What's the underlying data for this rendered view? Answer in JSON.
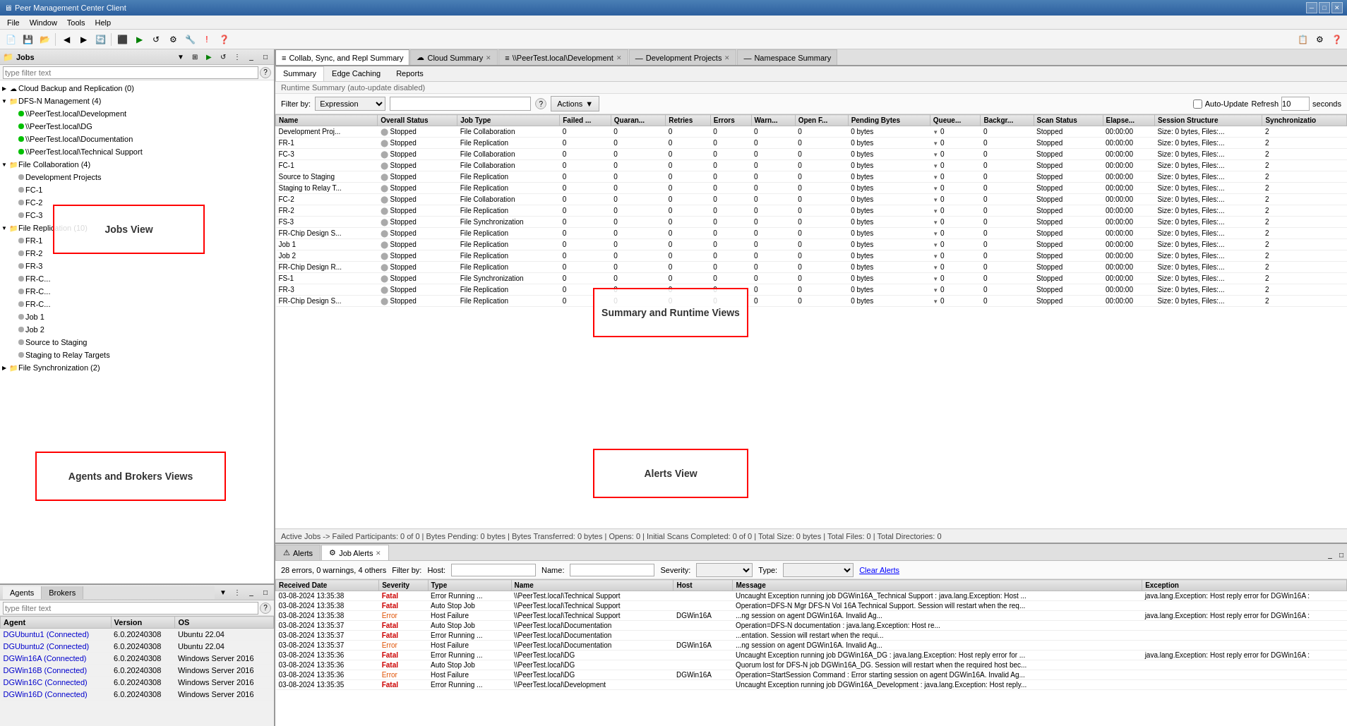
{
  "titleBar": {
    "title": "Peer Management Center Client",
    "icon": "🖥",
    "controls": [
      "─",
      "□",
      "✕"
    ]
  },
  "menuBar": {
    "items": [
      "File",
      "Window",
      "Tools",
      "Help"
    ]
  },
  "jobsPanel": {
    "title": "Jobs",
    "filterPlaceholder": "type filter text",
    "treeItems": [
      {
        "level": 0,
        "label": "Cloud Backup and Replication (0)",
        "icon": "☁",
        "expanded": true,
        "hasArrow": true
      },
      {
        "level": 0,
        "label": "DFS-N Management (4)",
        "icon": "📁",
        "expanded": true,
        "hasArrow": true
      },
      {
        "level": 1,
        "label": "\\\\PeerTest.local\\Development",
        "icon": "●",
        "dotColor": "green"
      },
      {
        "level": 1,
        "label": "\\\\PeerTest.local\\DG",
        "icon": "●",
        "dotColor": "green"
      },
      {
        "level": 1,
        "label": "\\\\PeerTest.local\\Documentation",
        "icon": "●",
        "dotColor": "green"
      },
      {
        "level": 1,
        "label": "\\\\PeerTest.local\\Technical Support",
        "icon": "●",
        "dotColor": "green"
      },
      {
        "level": 0,
        "label": "File Collaboration (4)",
        "icon": "📁",
        "expanded": true,
        "hasArrow": true
      },
      {
        "level": 1,
        "label": "Development Projects",
        "icon": "●",
        "dotColor": "gray"
      },
      {
        "level": 1,
        "label": "FC-1",
        "icon": "●",
        "dotColor": "gray"
      },
      {
        "level": 1,
        "label": "FC-2",
        "icon": "●",
        "dotColor": "gray"
      },
      {
        "level": 1,
        "label": "FC-3",
        "icon": "●",
        "dotColor": "gray"
      },
      {
        "level": 0,
        "label": "File Replication (10)",
        "icon": "📁",
        "expanded": true,
        "hasArrow": true
      },
      {
        "level": 1,
        "label": "FR-1",
        "icon": "●",
        "dotColor": "gray"
      },
      {
        "level": 1,
        "label": "FR-2",
        "icon": "●",
        "dotColor": "gray"
      },
      {
        "level": 1,
        "label": "FR-3",
        "icon": "●",
        "dotColor": "gray"
      },
      {
        "level": 1,
        "label": "FR-C...",
        "icon": "●",
        "dotColor": "gray"
      },
      {
        "level": 1,
        "label": "FR-C...",
        "icon": "●",
        "dotColor": "gray"
      },
      {
        "level": 1,
        "label": "FR-C...",
        "icon": "●",
        "dotColor": "gray"
      },
      {
        "level": 1,
        "label": "Job 1",
        "icon": "●",
        "dotColor": "gray"
      },
      {
        "level": 1,
        "label": "Job 2",
        "icon": "●",
        "dotColor": "gray"
      },
      {
        "level": 1,
        "label": "Source to Staging",
        "icon": "●",
        "dotColor": "gray"
      },
      {
        "level": 1,
        "label": "Staging to Relay Targets",
        "icon": "●",
        "dotColor": "gray"
      },
      {
        "level": 0,
        "label": "File Synchronization (2)",
        "icon": "📁",
        "expanded": false,
        "hasArrow": true
      }
    ]
  },
  "agentsPanel": {
    "tabs": [
      "Agents",
      "Brokers"
    ],
    "activeTab": "Agents",
    "filterPlaceholder": "type filter text",
    "columns": [
      "Agent",
      "Version",
      "OS"
    ],
    "rows": [
      {
        "agent": "DGUbuntu1 (Connected)",
        "version": "6.0.20240308",
        "os": "Ubuntu 22.04",
        "connected": true
      },
      {
        "agent": "DGUbuntu2 (Connected)",
        "version": "6.0.20240308",
        "os": "Ubuntu 22.04",
        "connected": true
      },
      {
        "agent": "DGWin16A (Connected)",
        "version": "6.0.20240308",
        "os": "Windows Server 2016",
        "connected": true
      },
      {
        "agent": "DGWin16B (Connected)",
        "version": "6.0.20240308",
        "os": "Windows Server 2016",
        "connected": true
      },
      {
        "agent": "DGWin16C (Connected)",
        "version": "6.0.20240308",
        "os": "Windows Server 2016",
        "connected": true
      },
      {
        "agent": "DGWin16D (Connected)",
        "version": "6.0.20240308",
        "os": "Windows Server 2016",
        "connected": true
      }
    ]
  },
  "mainTabs": [
    {
      "id": "collab",
      "label": "Collab, Sync, and Repl Summary",
      "icon": "≡",
      "active": true,
      "closable": false
    },
    {
      "id": "cloud",
      "label": "Cloud Summary",
      "icon": "☁",
      "active": false,
      "closable": true
    },
    {
      "id": "dev",
      "label": "\\\\PeerTest.local\\Development",
      "icon": "≡",
      "active": false,
      "closable": true
    },
    {
      "id": "devprojects",
      "label": "Development Projects",
      "icon": "—",
      "active": false,
      "closable": true
    },
    {
      "id": "namespace",
      "label": "Namespace Summary",
      "icon": "—",
      "active": false,
      "closable": false
    }
  ],
  "summaryInnerTabs": [
    "Summary",
    "Edge Caching",
    "Reports"
  ],
  "activeInnerTab": "Summary",
  "runtimeText": "Runtime Summary (auto-update disabled)",
  "filterByLabel": "Filter by:",
  "filterExpression": "Expression",
  "helpBtn": "?",
  "actionsLabel": "Actions",
  "autoUpdateLabel": "Auto-Update",
  "refreshLabel": "Refresh",
  "refreshValue": "10",
  "secondsLabel": "seconds",
  "gridColumns": [
    "Name",
    "Overall Status",
    "Job Type",
    "Failed ...",
    "Quaran...",
    "Retries",
    "Errors",
    "Warn...",
    "Open F...",
    "Pending Bytes",
    "Queue...",
    "Backgr...",
    "Scan Status",
    "Elapse...",
    "Session Structure",
    "Synchronizatio"
  ],
  "gridRows": [
    {
      "name": "Development Proj...",
      "status": "Stopped",
      "type": "File Collaboration",
      "failed": "0",
      "quaran": "0",
      "retries": "0",
      "errors": "0",
      "warn": "0",
      "openF": "0",
      "pendingBytes": "0 bytes",
      "queue": "0",
      "backgr": "0",
      "scanStatus": "Stopped",
      "elapsed": "00:00:00",
      "session": "Size: 0 bytes, Files:...",
      "sync": "2"
    },
    {
      "name": "FR-1",
      "status": "Stopped",
      "type": "File Replication",
      "failed": "0",
      "quaran": "0",
      "retries": "0",
      "errors": "0",
      "warn": "0",
      "openF": "0",
      "pendingBytes": "0 bytes",
      "queue": "0",
      "backgr": "0",
      "scanStatus": "Stopped",
      "elapsed": "00:00:00",
      "session": "Size: 0 bytes, Files:...",
      "sync": "2"
    },
    {
      "name": "FC-3",
      "status": "Stopped",
      "type": "File Collaboration",
      "failed": "0",
      "quaran": "0",
      "retries": "0",
      "errors": "0",
      "warn": "0",
      "openF": "0",
      "pendingBytes": "0 bytes",
      "queue": "0",
      "backgr": "0",
      "scanStatus": "Stopped",
      "elapsed": "00:00:00",
      "session": "Size: 0 bytes, Files:...",
      "sync": "2"
    },
    {
      "name": "FC-1",
      "status": "Stopped",
      "type": "File Collaboration",
      "failed": "0",
      "quaran": "0",
      "retries": "0",
      "errors": "0",
      "warn": "0",
      "openF": "0",
      "pendingBytes": "0 bytes",
      "queue": "0",
      "backgr": "0",
      "scanStatus": "Stopped",
      "elapsed": "00:00:00",
      "session": "Size: 0 bytes, Files:...",
      "sync": "2"
    },
    {
      "name": "Source to Staging",
      "status": "Stopped",
      "type": "File Replication",
      "failed": "0",
      "quaran": "0",
      "retries": "0",
      "errors": "0",
      "warn": "0",
      "openF": "0",
      "pendingBytes": "0 bytes",
      "queue": "0",
      "backgr": "0",
      "scanStatus": "Stopped",
      "elapsed": "00:00:00",
      "session": "Size: 0 bytes, Files:...",
      "sync": "2"
    },
    {
      "name": "Staging to Relay T...",
      "status": "Stopped",
      "type": "File Replication",
      "failed": "0",
      "quaran": "0",
      "retries": "0",
      "errors": "0",
      "warn": "0",
      "openF": "0",
      "pendingBytes": "0 bytes",
      "queue": "0",
      "backgr": "0",
      "scanStatus": "Stopped",
      "elapsed": "00:00:00",
      "session": "Size: 0 bytes, Files:...",
      "sync": "2"
    },
    {
      "name": "FC-2",
      "status": "Stopped",
      "type": "File Collaboration",
      "failed": "0",
      "quaran": "0",
      "retries": "0",
      "errors": "0",
      "warn": "0",
      "openF": "0",
      "pendingBytes": "0 bytes",
      "queue": "0",
      "backgr": "0",
      "scanStatus": "Stopped",
      "elapsed": "00:00:00",
      "session": "Size: 0 bytes, Files:...",
      "sync": "2"
    },
    {
      "name": "FR-2",
      "status": "Stopped",
      "type": "File Replication",
      "failed": "0",
      "quaran": "0",
      "retries": "0",
      "errors": "0",
      "warn": "0",
      "openF": "0",
      "pendingBytes": "0 bytes",
      "queue": "0",
      "backgr": "0",
      "scanStatus": "Stopped",
      "elapsed": "00:00:00",
      "session": "Size: 0 bytes, Files:...",
      "sync": "2"
    },
    {
      "name": "FS-3",
      "status": "Stopped",
      "type": "File Synchronization",
      "failed": "0",
      "quaran": "0",
      "retries": "0",
      "errors": "0",
      "warn": "0",
      "openF": "0",
      "pendingBytes": "0 bytes",
      "queue": "0",
      "backgr": "0",
      "scanStatus": "Stopped",
      "elapsed": "00:00:00",
      "session": "Size: 0 bytes, Files:...",
      "sync": "2"
    },
    {
      "name": "FR-Chip Design S...",
      "status": "Stopped",
      "type": "File Replication",
      "failed": "0",
      "quaran": "0",
      "retries": "0",
      "errors": "0",
      "warn": "0",
      "openF": "0",
      "pendingBytes": "0 bytes",
      "queue": "0",
      "backgr": "0",
      "scanStatus": "Stopped",
      "elapsed": "00:00:00",
      "session": "Size: 0 bytes, Files:...",
      "sync": "2"
    },
    {
      "name": "Job 1",
      "status": "Stopped",
      "type": "File Replication",
      "failed": "0",
      "quaran": "0",
      "retries": "0",
      "errors": "0",
      "warn": "0",
      "openF": "0",
      "pendingBytes": "0 bytes",
      "queue": "0",
      "backgr": "0",
      "scanStatus": "Stopped",
      "elapsed": "00:00:00",
      "session": "Size: 0 bytes, Files:...",
      "sync": "2"
    },
    {
      "name": "Job 2",
      "status": "Stopped",
      "type": "File Replication",
      "failed": "0",
      "quaran": "0",
      "retries": "0",
      "errors": "0",
      "warn": "0",
      "openF": "0",
      "pendingBytes": "0 bytes",
      "queue": "0",
      "backgr": "0",
      "scanStatus": "Stopped",
      "elapsed": "00:00:00",
      "session": "Size: 0 bytes, Files:...",
      "sync": "2"
    },
    {
      "name": "FR-Chip Design R...",
      "status": "Stopped",
      "type": "File Replication",
      "failed": "0",
      "quaran": "0",
      "retries": "0",
      "errors": "0",
      "warn": "0",
      "openF": "0",
      "pendingBytes": "0 bytes",
      "queue": "0",
      "backgr": "0",
      "scanStatus": "Stopped",
      "elapsed": "00:00:00",
      "session": "Size: 0 bytes, Files:...",
      "sync": "2"
    },
    {
      "name": "FS-1",
      "status": "Stopped",
      "type": "File Synchronization",
      "failed": "0",
      "quaran": "0",
      "retries": "0",
      "errors": "0",
      "warn": "0",
      "openF": "0",
      "pendingBytes": "0 bytes",
      "queue": "0",
      "backgr": "0",
      "scanStatus": "Stopped",
      "elapsed": "00:00:00",
      "session": "Size: 0 bytes, Files:...",
      "sync": "2"
    },
    {
      "name": "FR-3",
      "status": "Stopped",
      "type": "File Replication",
      "failed": "0",
      "quaran": "0",
      "retries": "0",
      "errors": "0",
      "warn": "0",
      "openF": "0",
      "pendingBytes": "0 bytes",
      "queue": "0",
      "backgr": "0",
      "scanStatus": "Stopped",
      "elapsed": "00:00:00",
      "session": "Size: 0 bytes, Files:...",
      "sync": "2"
    },
    {
      "name": "FR-Chip Design S...",
      "status": "Stopped",
      "type": "File Replication",
      "failed": "0",
      "quaran": "0",
      "retries": "0",
      "errors": "0",
      "warn": "0",
      "openF": "0",
      "pendingBytes": "0 bytes",
      "queue": "0",
      "backgr": "0",
      "scanStatus": "Stopped",
      "elapsed": "00:00:00",
      "session": "Size: 0 bytes, Files:...",
      "sync": "2"
    }
  ],
  "statusBar": "Active Jobs -> Failed Participants: 0 of 0  |  Bytes Pending: 0 bytes  |  Bytes Transferred: 0 bytes  |  Opens: 0  |  Initial Scans Completed: 0 of 0  |  Total Size: 0 bytes  |  Total Files: 0  |  Total Directories: 0",
  "alertsTabs": [
    {
      "id": "alerts",
      "label": "Alerts",
      "icon": "⚠",
      "active": false
    },
    {
      "id": "jobalerts",
      "label": "Job Alerts",
      "icon": "⚙",
      "active": true,
      "closable": true
    }
  ],
  "alertsCount": "28 errors, 0 warnings, 4 others",
  "alertsFilterLabels": {
    "filterBy": "Filter by:",
    "host": "Host:",
    "name": "Name:",
    "severity": "Severity:",
    "type": "Type:",
    "clearAlerts": "Clear Alerts"
  },
  "alertsColumns": [
    "Received Date",
    "Severity",
    "Type",
    "Name",
    "Host",
    "Message",
    "Exception"
  ],
  "alertsRows": [
    {
      "date": "03-08-2024 13:35:38",
      "severity": "Fatal",
      "type": "Error Running ...",
      "name": "\\\\PeerTest.local\\Technical Support",
      "host": "",
      "message": "Uncaught Exception running job DGWin16A_Technical Support : java.lang.Exception: Host ...",
      "exception": "java.lang.Exception: Host reply error for DGWin16A :"
    },
    {
      "date": "03-08-2024 13:35:38",
      "severity": "Fatal",
      "type": "Auto Stop Job",
      "name": "\\\\PeerTest.local\\Technical Support",
      "host": "",
      "message": "Operation=DFS-N Mgr DFS-N Vol 16A Technical Support. Session will restart when the req...",
      "exception": ""
    },
    {
      "date": "03-08-2024 13:35:38",
      "severity": "Error",
      "type": "Host Failure",
      "name": "\\\\PeerTest.local\\Technical Support",
      "host": "DGWin16A",
      "message": "...ng session on agent DGWin16A. Invalid Ag...",
      "exception": "java.lang.Exception: Host reply error for DGWin16A :"
    },
    {
      "date": "03-08-2024 13:35:37",
      "severity": "Fatal",
      "type": "Auto Stop Job",
      "name": "\\\\PeerTest.local\\Documentation",
      "host": "",
      "message": "Operation=DFS-N documentation : java.lang.Exception: Host re...",
      "exception": ""
    },
    {
      "date": "03-08-2024 13:35:37",
      "severity": "Fatal",
      "type": "Error Running ...",
      "name": "\\\\PeerTest.local\\Documentation",
      "host": "",
      "message": "...entation. Session will restart when the requi...",
      "exception": ""
    },
    {
      "date": "03-08-2024 13:35:37",
      "severity": "Error",
      "type": "Host Failure",
      "name": "\\\\PeerTest.local\\Documentation",
      "host": "DGWin16A",
      "message": "...ng session on agent DGWin16A. Invalid Ag...",
      "exception": ""
    },
    {
      "date": "03-08-2024 13:35:36",
      "severity": "Fatal",
      "type": "Error Running ...",
      "name": "\\\\PeerTest.local\\DG",
      "host": "",
      "message": "Uncaught Exception running job DGWin16A_DG : java.lang.Exception: Host reply error for ...",
      "exception": "java.lang.Exception: Host reply error for DGWin16A :"
    },
    {
      "date": "03-08-2024 13:35:36",
      "severity": "Fatal",
      "type": "Auto Stop Job",
      "name": "\\\\PeerTest.local\\DG",
      "host": "",
      "message": "Quorum lost for DFS-N job DGWin16A_DG. Session will restart when the required host bec...",
      "exception": ""
    },
    {
      "date": "03-08-2024 13:35:36",
      "severity": "Error",
      "type": "Host Failure",
      "name": "\\\\PeerTest.local\\DG",
      "host": "DGWin16A",
      "message": "Operation=StartSession Command : Error starting session on agent DGWin16A. Invalid Ag...",
      "exception": ""
    },
    {
      "date": "03-08-2024 13:35:35",
      "severity": "Fatal",
      "type": "Error Running ...",
      "name": "\\\\PeerTest.local\\Development",
      "host": "",
      "message": "Uncaught Exception running job DGWin16A_Development : java.lang.Exception: Host reply...",
      "exception": ""
    }
  ],
  "annotations": {
    "jobsView": "Jobs View",
    "summaryRuntimeView": "Summary and Runtime Views",
    "agentsBrokersView": "Agents and Brokers Views",
    "alertsView": "Alerts View"
  }
}
